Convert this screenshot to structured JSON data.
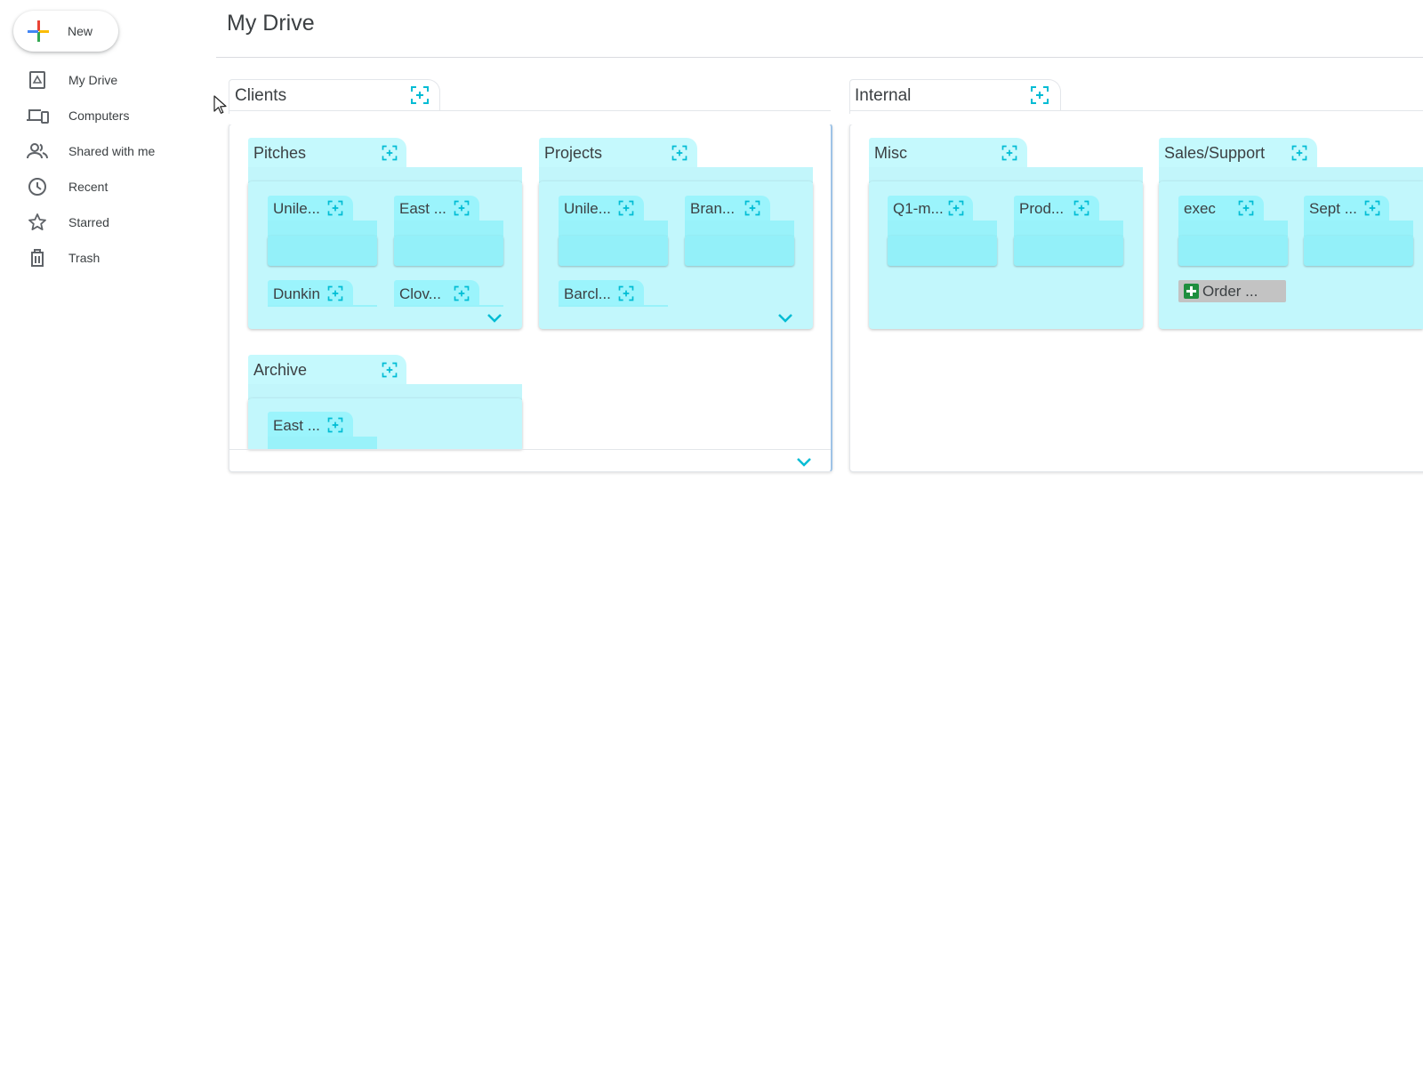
{
  "sidebar": {
    "new_label": "New",
    "items": [
      {
        "label": "My Drive",
        "icon": "drive-icon"
      },
      {
        "label": "Computers",
        "icon": "computers-icon"
      },
      {
        "label": "Shared with me",
        "icon": "shared-icon"
      },
      {
        "label": "Recent",
        "icon": "clock-icon"
      },
      {
        "label": "Starred",
        "icon": "star-icon"
      },
      {
        "label": "Trash",
        "icon": "trash-icon"
      }
    ]
  },
  "header": {
    "title": "My Drive"
  },
  "colors": {
    "accent": "#00bcd4",
    "folder_tab": "#c5f9fd",
    "mini_folder": "#93f0f9",
    "sheet_green": "#1e8e3e"
  },
  "panels": {
    "clients": {
      "title": "Clients",
      "folders": {
        "pitches": {
          "title": "Pitches",
          "children": [
            "Unile...",
            "East ...",
            "Dunkin",
            "Clov..."
          ]
        },
        "projects": {
          "title": "Projects",
          "children": [
            "Unile...",
            "Bran...",
            "Barcl..."
          ]
        },
        "archive": {
          "title": "Archive",
          "children": [
            "East ..."
          ]
        }
      }
    },
    "internal": {
      "title": "Internal",
      "folders": {
        "misc": {
          "title": "Misc",
          "children": [
            "Q1-m...",
            "Prod..."
          ]
        },
        "sales": {
          "title": "Sales/Support",
          "children": [
            "exec",
            "Sept ..."
          ],
          "files": [
            "Order ..."
          ]
        }
      }
    }
  }
}
